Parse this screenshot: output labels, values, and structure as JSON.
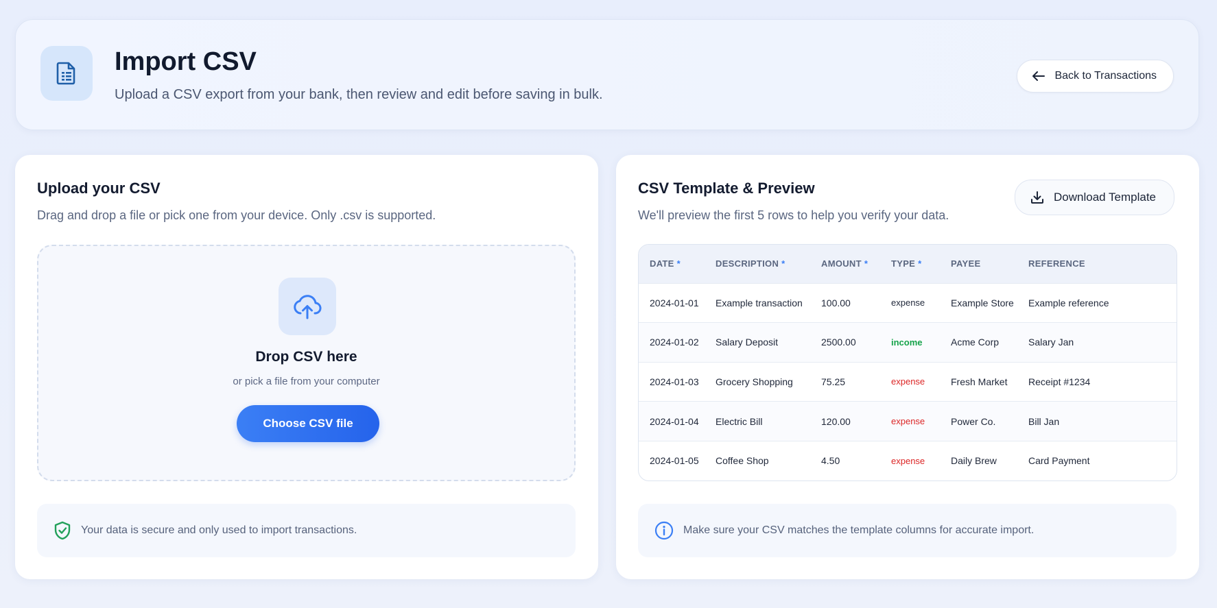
{
  "header": {
    "title": "Import CSV",
    "subtitle": "Upload a CSV export from your bank, then review and edit before saving in bulk.",
    "back_label": "Back to Transactions"
  },
  "upload": {
    "title": "Upload your CSV",
    "subtitle": "Drag and drop a file or pick one from your device. Only .csv  is supported.",
    "drop_title": "Drop CSV here",
    "drop_sub": "or pick a file from your computer",
    "choose_label": "Choose CSV file",
    "note": "Your data is secure and only used to import transactions."
  },
  "preview": {
    "title": "CSV Template & Preview",
    "subtitle": "We'll preview the first 5 rows to help you verify your data.",
    "download_label": "Download Template",
    "note": "Make sure your CSV matches the template columns for accurate import.",
    "columns": [
      {
        "label": "DATE",
        "required": "*"
      },
      {
        "label": "DESCRIPTION",
        "required": "*"
      },
      {
        "label": "AMOUNT",
        "required": "*"
      },
      {
        "label": "TYPE",
        "required": "*"
      },
      {
        "label": "PAYEE",
        "required": ""
      },
      {
        "label": "REFERENCE",
        "required": ""
      }
    ],
    "rows": [
      {
        "date": "2024-01-01",
        "description": "Example transaction",
        "amount": "100.00",
        "type": "expense",
        "payee": "Example Store",
        "reference": "Example reference"
      },
      {
        "date": "2024-01-02",
        "description": "Salary Deposit",
        "amount": "2500.00",
        "type": "income",
        "payee": "Acme Corp",
        "reference": "Salary Jan"
      },
      {
        "date": "2024-01-03",
        "description": "Grocery Shopping",
        "amount": "75.25",
        "type": "expense",
        "payee": "Fresh Market",
        "reference": "Receipt #1234"
      },
      {
        "date": "2024-01-04",
        "description": "Electric Bill",
        "amount": "120.00",
        "type": "expense",
        "payee": "Power Co.",
        "reference": "Bill Jan"
      },
      {
        "date": "2024-01-05",
        "description": "Coffee Shop",
        "amount": "4.50",
        "type": "expense",
        "payee": "Daily Brew",
        "reference": "Card Payment"
      }
    ]
  },
  "colors": {
    "accent": "#2563eb",
    "income": "#16a34a",
    "expense": "#dc2626",
    "secure": "#22a05a"
  }
}
